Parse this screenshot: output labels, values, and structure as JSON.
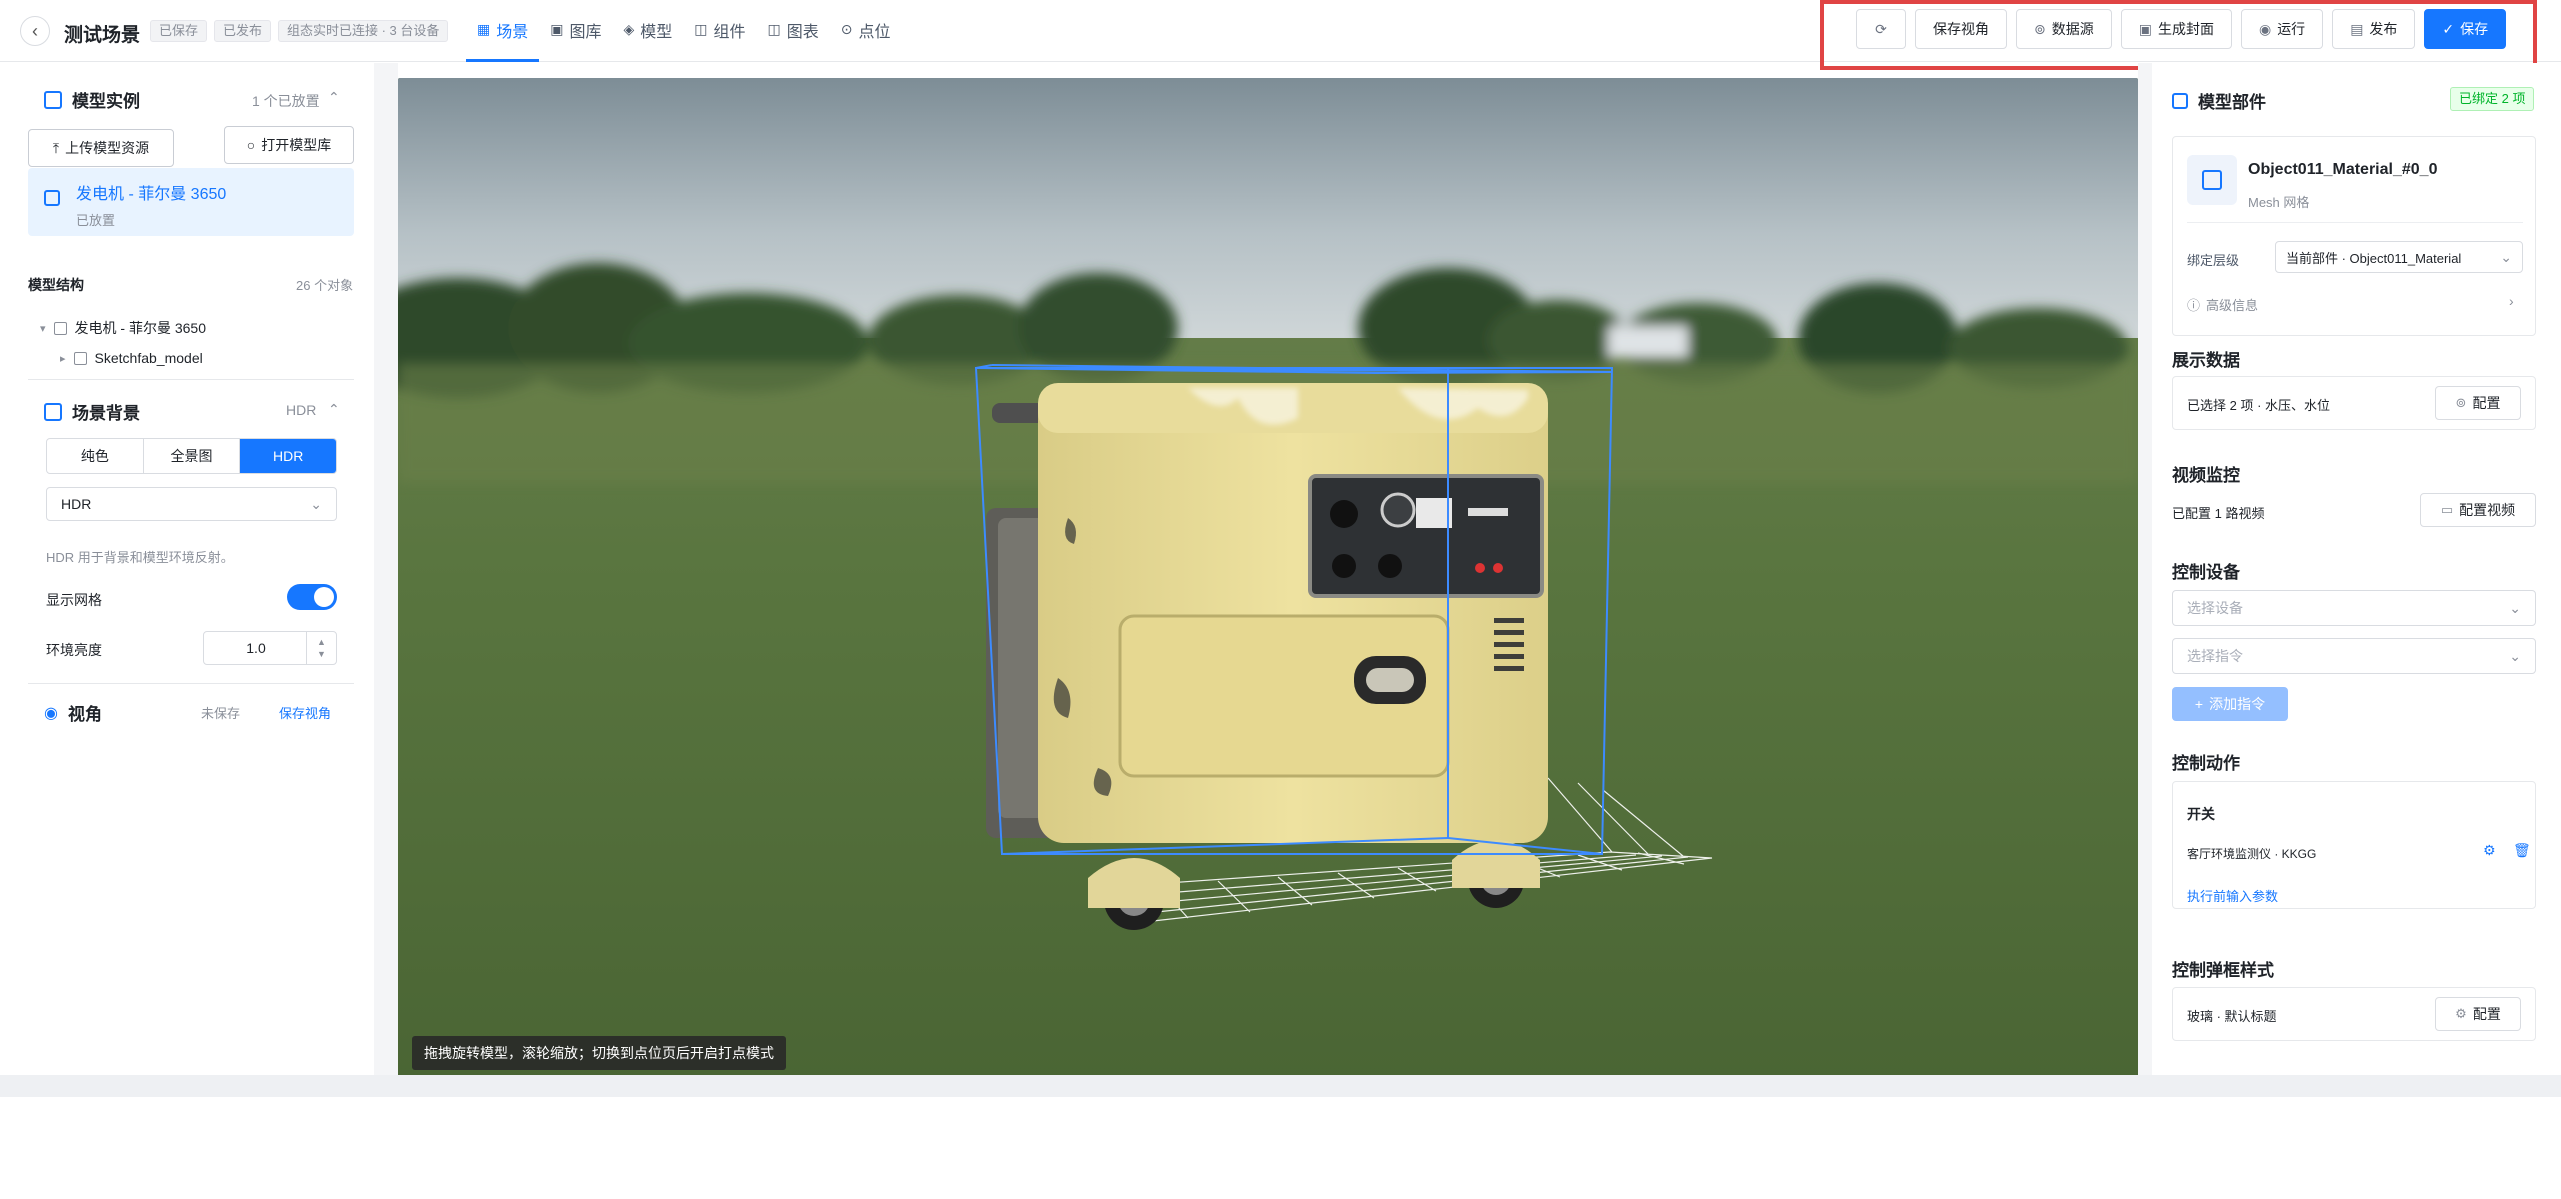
{
  "header": {
    "title": "测试场景",
    "tags": [
      "已保存",
      "已发布",
      "组态实时已连接 · 3 台设备"
    ],
    "nav": [
      {
        "label": "场景",
        "icon": "grid-icon",
        "active": true
      },
      {
        "label": "图库",
        "icon": "image-icon",
        "active": false
      },
      {
        "label": "模型",
        "icon": "cube-icon",
        "active": false
      },
      {
        "label": "组件",
        "icon": "component-icon",
        "active": false
      },
      {
        "label": "图表",
        "icon": "chart-icon",
        "active": false
      },
      {
        "label": "点位",
        "icon": "pin-icon",
        "active": false
      }
    ],
    "toolbar": {
      "save_view": "保存视角",
      "datasource": "数据源",
      "cover": "生成封面",
      "run": "运行",
      "publish": "发布",
      "save": "保存"
    }
  },
  "left": {
    "models": {
      "title": "模型实例",
      "count": "1 个已放置",
      "upload": "上传模型资源",
      "open_library": "打开模型库",
      "item_name": "发电机 - 菲尔曼 3650",
      "item_status": "已放置"
    },
    "structure": {
      "title": "模型结构",
      "count": "26 个对象",
      "root": "发电机 - 菲尔曼 3650",
      "child": "Sketchfab_model"
    },
    "background": {
      "title": "场景背景",
      "mode": "HDR",
      "tabs": [
        "纯色",
        "全景图",
        "HDR"
      ],
      "select_value": "HDR",
      "desc": "HDR 用于背景和模型环境反射。",
      "grid_label": "显示网格",
      "grid_on": true,
      "brightness_label": "环境亮度",
      "brightness": "1.0"
    },
    "view": {
      "title": "视角",
      "status": "未保存",
      "save_link": "保存视角"
    }
  },
  "viewport": {
    "hint": "拖拽旋转模型，滚轮缩放；切换到点位页后开启打点模式"
  },
  "right": {
    "part": {
      "title": "模型部件",
      "bound": "已绑定 2 项",
      "name": "Object011_Material_#0_0",
      "type": "Mesh 网格",
      "bind_label": "绑定层级",
      "bind_value": "当前部件 · Object011_Material",
      "advanced": "高级信息"
    },
    "display": {
      "title": "展示数据",
      "selected": "已选择 2 项 · 水压、水位",
      "config": "配置"
    },
    "video": {
      "title": "视频监控",
      "status": "已配置 1 路视频",
      "config": "配置视频"
    },
    "control": {
      "title": "控制设备",
      "device_ph": "选择设备",
      "command_ph": "选择指令",
      "add": "添加指令"
    },
    "action": {
      "title": "控制动作",
      "name": "开关",
      "device": "客厅环境监测仪 · KKGG",
      "link": "执行前输入参数"
    },
    "popup": {
      "title": "控制弹框样式",
      "value": "玻璃 · 默认标题",
      "config": "配置"
    }
  },
  "colors": {
    "primary": "#1677ff",
    "highlight": "#e04444",
    "success": "#00b42a"
  }
}
